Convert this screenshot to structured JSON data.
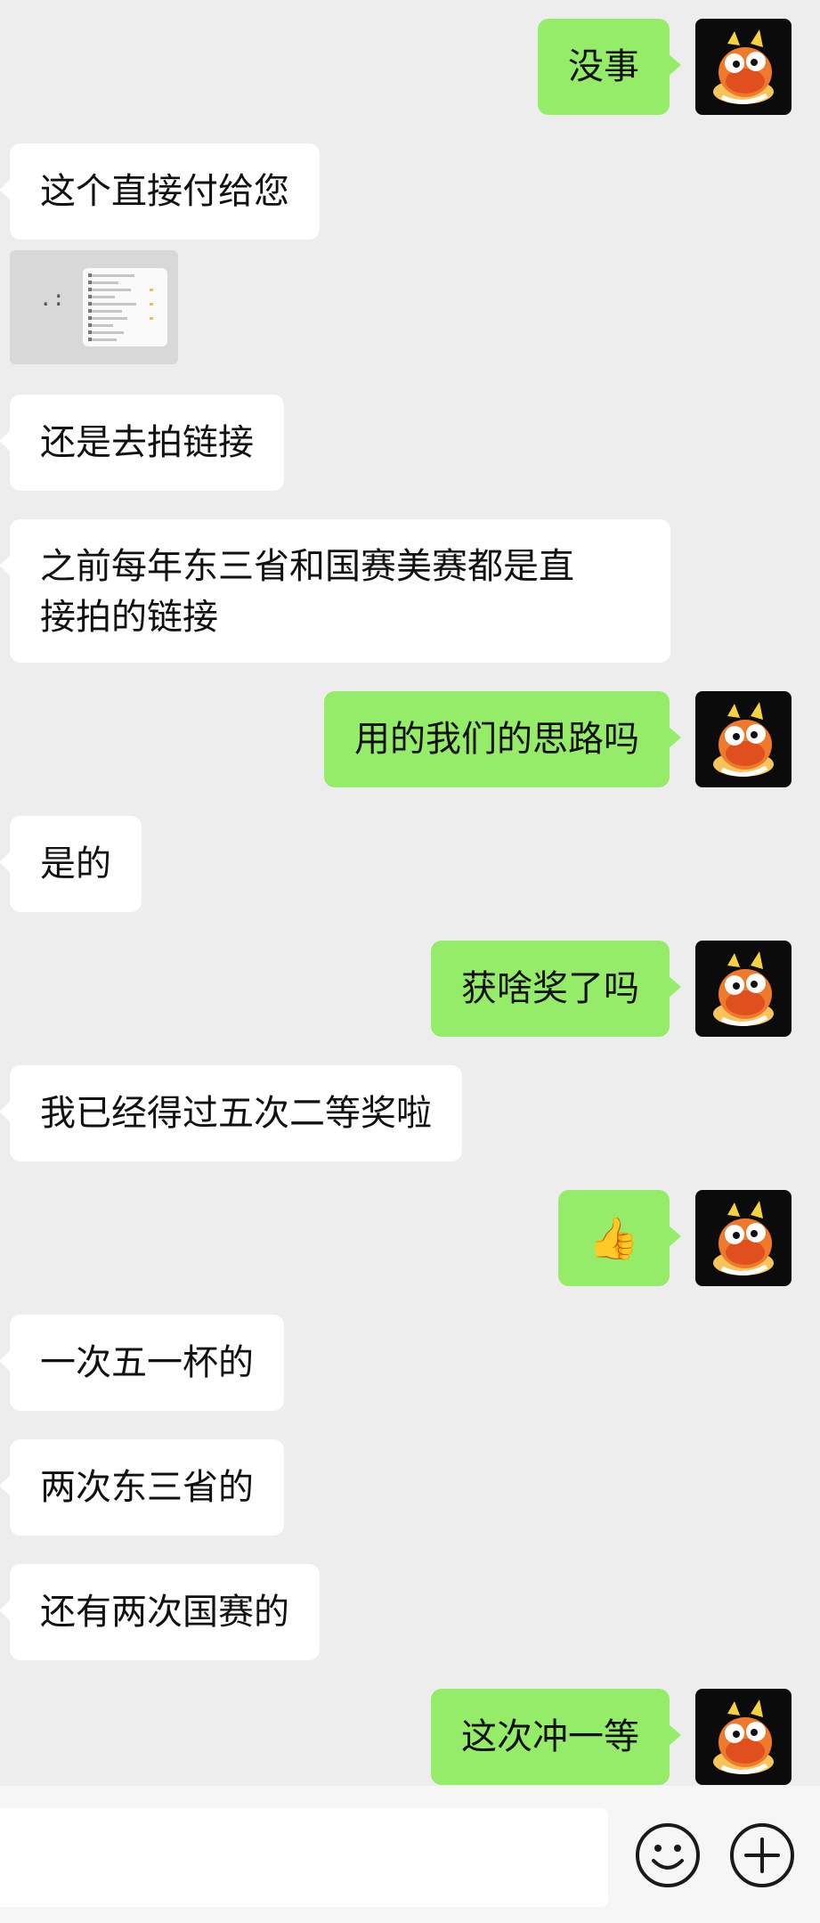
{
  "messages": [
    {
      "side": "out",
      "text": "没事"
    },
    {
      "side": "in",
      "text": "这个直接付给您"
    },
    {
      "side": "in",
      "type": "file",
      "icon": "document-thumbnail-icon"
    },
    {
      "side": "in",
      "text": "还是去拍链接"
    },
    {
      "side": "in",
      "text_lines": [
        "之前每年东三省和国赛美赛都是直",
        "接拍的链接"
      ]
    },
    {
      "side": "out",
      "text": "用的我们的思路吗"
    },
    {
      "side": "in",
      "text": "是的"
    },
    {
      "side": "out",
      "text": "获啥奖了吗"
    },
    {
      "side": "in",
      "text": "我已经得过五次二等奖啦"
    },
    {
      "side": "out",
      "emoji": "👍"
    },
    {
      "side": "in",
      "text": "一次五一杯的"
    },
    {
      "side": "in",
      "text": "两次东三省的"
    },
    {
      "side": "in",
      "text": "还有两次国赛的"
    },
    {
      "side": "out",
      "text": "这次冲一等"
    }
  ],
  "input_bar": {
    "value": "",
    "emoji_icon": "emoji-smiley-icon",
    "plus_icon": "plus-icon"
  },
  "colors": {
    "background": "#ededed",
    "incoming_bubble": "#ffffff",
    "outgoing_bubble": "#95ec69",
    "avatar_bg": "#0b0b0b"
  }
}
